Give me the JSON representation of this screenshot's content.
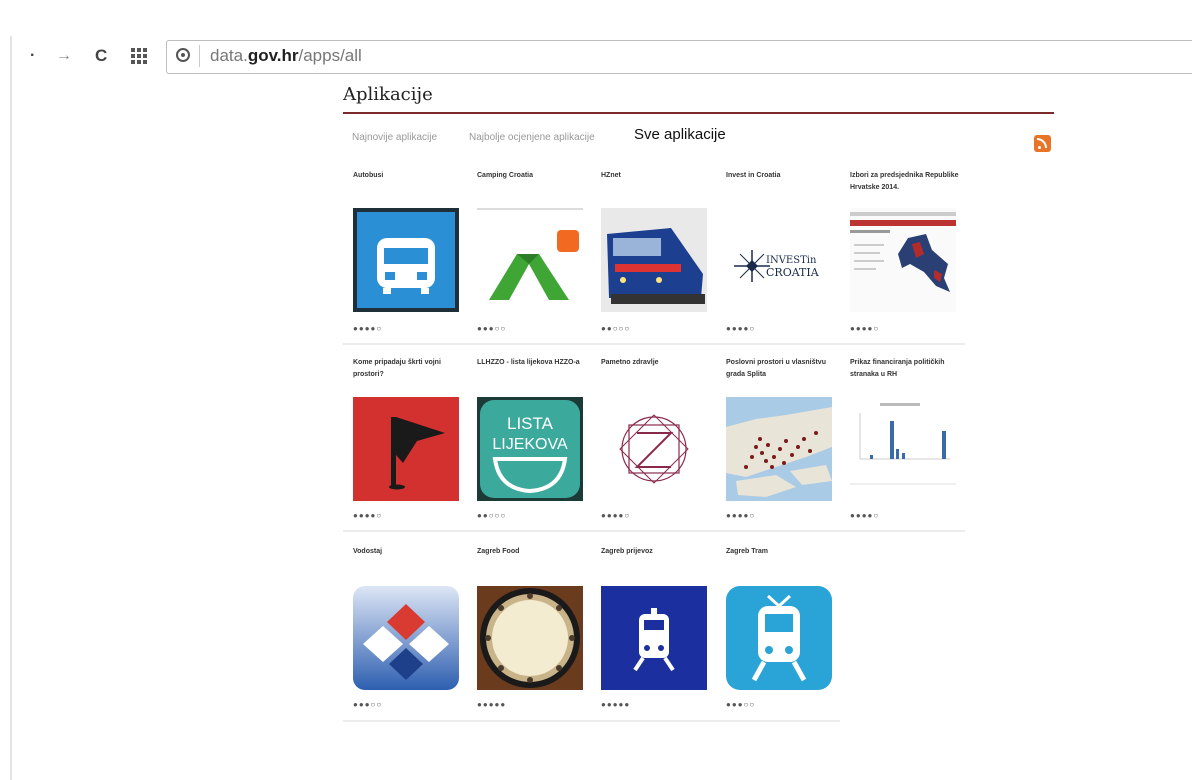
{
  "browser": {
    "url_prefix": "data.",
    "url_domain": "gov.hr",
    "url_path": "/apps/all"
  },
  "page": {
    "title": "Aplikacije",
    "accent_color": "#7a2a2a"
  },
  "tabs": [
    {
      "label": "Najnovije aplikacije",
      "active": false
    },
    {
      "label": "Najbolje ocjenjene aplikacije",
      "active": false
    },
    {
      "label": "Sve aplikacije",
      "active": true
    }
  ],
  "rss_icon": "rss-feed-icon",
  "apps": [
    {
      "name": "Autobusi",
      "icon": "bus-icon",
      "rating": 4
    },
    {
      "name": "Camping Croatia",
      "icon": "tent-icon",
      "rating": 3
    },
    {
      "name": "HZnet",
      "icon": "train-photo-icon",
      "rating": 2
    },
    {
      "name": "Invest in Croatia",
      "icon": "invest-in-croatia-logo",
      "rating": 4,
      "logo_text": "INVESTin",
      "logo_text2": "CROATIA"
    },
    {
      "name": "Izbori za predsjednika Republike Hrvatske 2014.",
      "icon": "election-map-icon",
      "rating": 4
    },
    {
      "name": "Kome pripadaju škrti vojni prostori?",
      "icon": "flag-icon",
      "rating": 4
    },
    {
      "name": "LLHZZO - lista lijekova HZZO-a",
      "icon": "lista-lijekova-icon",
      "rating": 2,
      "logo_text": "LISTA",
      "logo_text2": "LIJEKOVA"
    },
    {
      "name": "Pametno zdravlje",
      "icon": "z-logo-icon",
      "rating": 4
    },
    {
      "name": "Poslovni prostori u vlasništvu grada Splita",
      "icon": "split-map-icon",
      "rating": 4
    },
    {
      "name": "Prikaz financiranja političkih stranaka u RH",
      "icon": "bar-chart-icon",
      "rating": 4
    },
    {
      "name": "Vodostaj",
      "icon": "water-level-icon",
      "rating": 3
    },
    {
      "name": "Zagreb Food",
      "icon": "plate-icon",
      "rating": 5
    },
    {
      "name": "Zagreb prijevoz",
      "icon": "train-icon",
      "rating": 5
    },
    {
      "name": "Zagreb Tram",
      "icon": "tram-icon",
      "rating": 3
    }
  ]
}
